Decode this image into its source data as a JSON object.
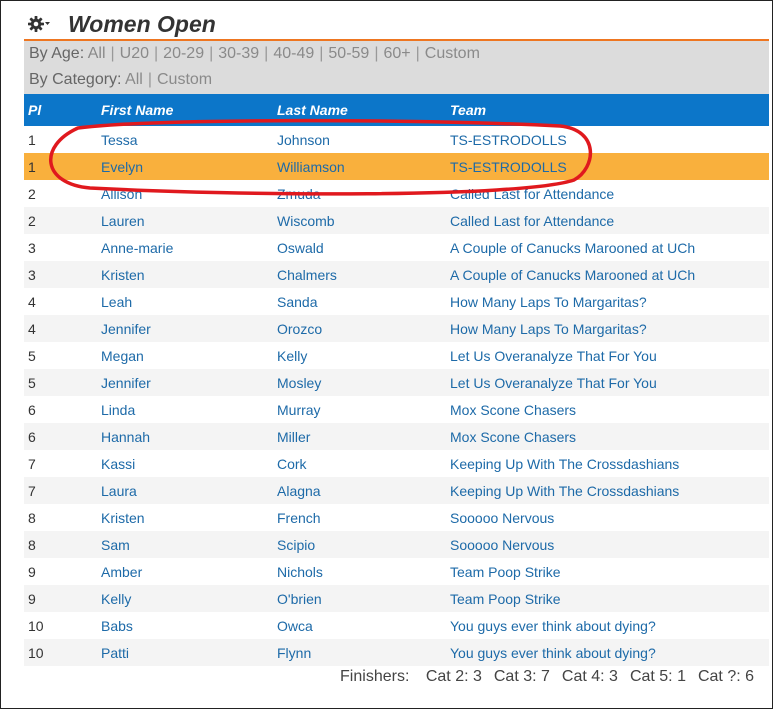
{
  "header": {
    "title": "Women Open",
    "icon": "gear-icon"
  },
  "filters": {
    "age_label": "By Age:",
    "age_options": [
      "All",
      "U20",
      "20-29",
      "30-39",
      "40-49",
      "50-59",
      "60+",
      "Custom"
    ],
    "category_label": "By Category:",
    "category_options": [
      "All",
      "Custom"
    ]
  },
  "table": {
    "columns": [
      "Pl",
      "First Name",
      "Last Name",
      "Team"
    ],
    "rows": [
      {
        "pl": "1",
        "first": "Tessa",
        "last": "Johnson",
        "team": "TS-ESTRODOLLS",
        "highlight": false
      },
      {
        "pl": "1",
        "first": "Evelyn",
        "last": "Williamson",
        "team": "TS-ESTRODOLLS",
        "highlight": true
      },
      {
        "pl": "2",
        "first": "Allison",
        "last": "Zmuda",
        "team": "Called Last for Attendance",
        "highlight": false
      },
      {
        "pl": "2",
        "first": "Lauren",
        "last": "Wiscomb",
        "team": "Called Last for Attendance",
        "highlight": false
      },
      {
        "pl": "3",
        "first": "Anne-marie",
        "last": "Oswald",
        "team": "A Couple of Canucks Marooned at UCh",
        "highlight": false
      },
      {
        "pl": "3",
        "first": "Kristen",
        "last": "Chalmers",
        "team": "A Couple of Canucks Marooned at UCh",
        "highlight": false
      },
      {
        "pl": "4",
        "first": "Leah",
        "last": "Sanda",
        "team": "How Many Laps To Margaritas?",
        "highlight": false
      },
      {
        "pl": "4",
        "first": "Jennifer",
        "last": "Orozco",
        "team": "How Many Laps To Margaritas?",
        "highlight": false
      },
      {
        "pl": "5",
        "first": "Megan",
        "last": "Kelly",
        "team": "Let Us Overanalyze That For You",
        "highlight": false
      },
      {
        "pl": "5",
        "first": "Jennifer",
        "last": "Mosley",
        "team": "Let Us Overanalyze That For You",
        "highlight": false
      },
      {
        "pl": "6",
        "first": "Linda",
        "last": "Murray",
        "team": "Mox Scone Chasers",
        "highlight": false
      },
      {
        "pl": "6",
        "first": "Hannah",
        "last": "Miller",
        "team": "Mox Scone Chasers",
        "highlight": false
      },
      {
        "pl": "7",
        "first": "Kassi",
        "last": "Cork",
        "team": "Keeping Up With The Crossdashians",
        "highlight": false
      },
      {
        "pl": "7",
        "first": "Laura",
        "last": "Alagna",
        "team": "Keeping Up With The Crossdashians",
        "highlight": false
      },
      {
        "pl": "8",
        "first": "Kristen",
        "last": "French",
        "team": "Sooooo Nervous",
        "highlight": false
      },
      {
        "pl": "8",
        "first": "Sam",
        "last": "Scipio",
        "team": "Sooooo Nervous",
        "highlight": false
      },
      {
        "pl": "9",
        "first": "Amber",
        "last": "Nichols",
        "team": "Team Poop Strike",
        "highlight": false
      },
      {
        "pl": "9",
        "first": "Kelly",
        "last": "O'brien",
        "team": "Team Poop Strike",
        "highlight": false
      },
      {
        "pl": "10",
        "first": "Babs",
        "last": "Owca",
        "team": "You guys ever think about dying?",
        "highlight": false
      },
      {
        "pl": "10",
        "first": "Patti",
        "last": "Flynn",
        "team": "You guys ever think about dying?",
        "highlight": false
      }
    ]
  },
  "finishers": {
    "label": "Finishers:",
    "items": [
      "Cat 2: 3",
      "Cat 3: 7",
      "Cat 4: 3",
      "Cat 5: 1",
      "Cat ?: 6"
    ]
  },
  "colors": {
    "accent_line": "#ee7621",
    "table_header": "#0c76c9",
    "highlight_row": "#f9b03d",
    "link": "#1d6aa8",
    "annotation": "#e0191e"
  }
}
